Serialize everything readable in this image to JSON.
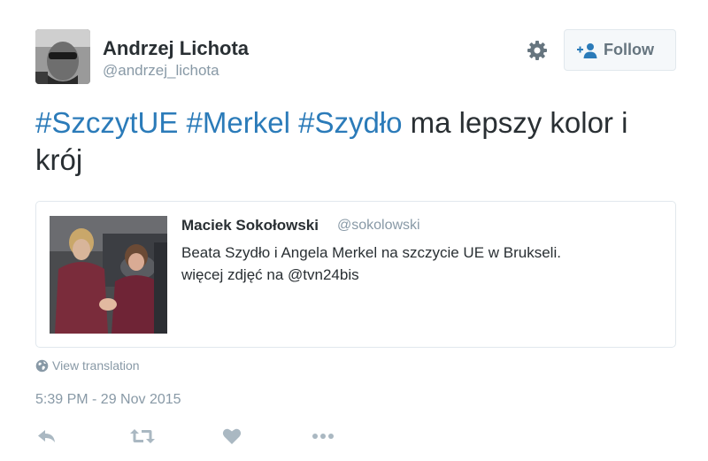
{
  "author": {
    "name": "Andrzej Lichota",
    "handle": "@andrzej_lichota"
  },
  "follow_button": {
    "label": "Follow",
    "icon": "add-user-icon"
  },
  "tweet": {
    "hashtags": [
      "#SzczytUE",
      "#Merkel",
      "#Szydło"
    ],
    "text_rest": "ma lepszy kolor i krój"
  },
  "quoted_tweet": {
    "name": "Maciek Sokołowski",
    "handle": "@sokolowski",
    "line1": "Beata Szydło i Angela Merkel na szczycie UE w Brukseli.",
    "line2_prefix": "więcej zdjęć na",
    "line2_mention": "@tvn24bis"
  },
  "translation_link": "View translation",
  "timestamp": "5:39 PM - 29 Nov 2015",
  "actions": [
    "reply-icon",
    "retweet-icon",
    "like-icon",
    "more-icon"
  ],
  "colors": {
    "link": "#2b7bb9",
    "text": "#292f33",
    "muted": "#8899a6",
    "border": "#e1e8ed"
  }
}
